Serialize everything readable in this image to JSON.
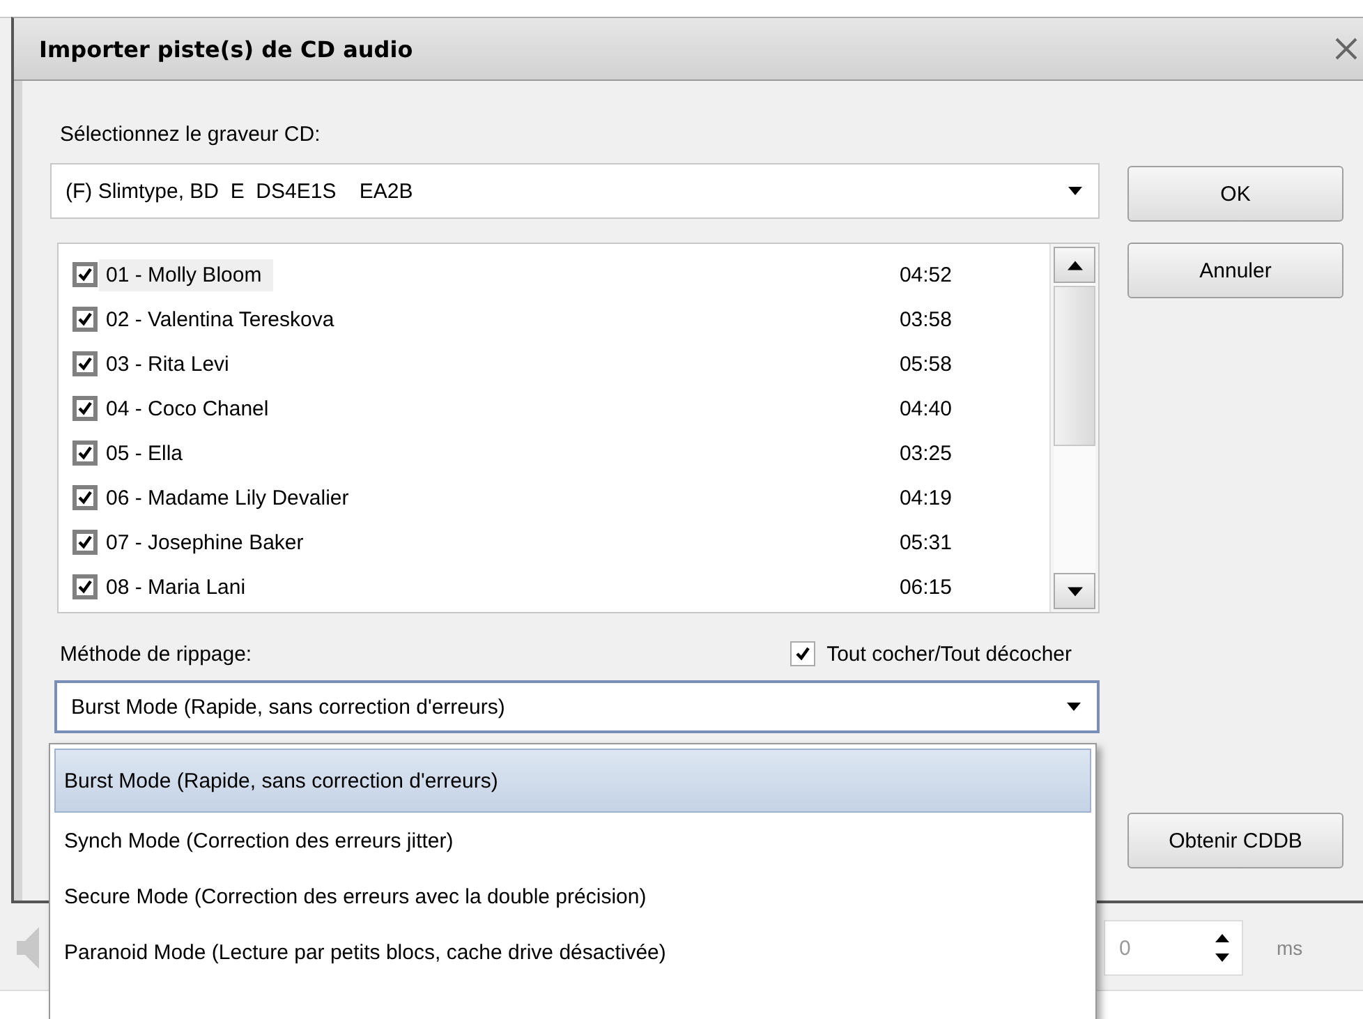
{
  "window": {
    "title": "Importer piste(s) de CD audio"
  },
  "drive": {
    "label": "Sélectionnez le graveur CD:",
    "value": "(F) Slimtype, BD  E  DS4E1S    EA2B"
  },
  "ok_button": {
    "label": "OK"
  },
  "cancel_button": {
    "label": "Annuler"
  },
  "tracks": [
    {
      "title": "01 - Molly Bloom",
      "duration": "04:52",
      "checked": true,
      "selected": true
    },
    {
      "title": "02 - Valentina Tereskova",
      "duration": "03:58",
      "checked": true,
      "selected": false
    },
    {
      "title": "03 - Rita Levi",
      "duration": "05:58",
      "checked": true,
      "selected": false
    },
    {
      "title": "04 - Coco Chanel",
      "duration": "04:40",
      "checked": true,
      "selected": false
    },
    {
      "title": "05 - Ella",
      "duration": "03:25",
      "checked": true,
      "selected": false
    },
    {
      "title": "06 - Madame Lily Devalier",
      "duration": "04:19",
      "checked": true,
      "selected": false
    },
    {
      "title": "07 - Josephine Baker",
      "duration": "05:31",
      "checked": true,
      "selected": false
    },
    {
      "title": "08 - Maria Lani",
      "duration": "06:15",
      "checked": true,
      "selected": false
    }
  ],
  "method": {
    "label": "Méthode de rippage:",
    "value": "Burst Mode (Rapide, sans correction d'erreurs)",
    "options": [
      {
        "label": "Burst Mode (Rapide, sans correction d'erreurs)",
        "selected": true
      },
      {
        "label": "Synch Mode (Correction des erreurs jitter)",
        "selected": false
      },
      {
        "label": "Secure Mode (Correction des erreurs avec la double précision)",
        "selected": false
      },
      {
        "label": "Paranoid Mode (Lecture par petits blocs, cache drive désactivée)",
        "selected": false
      }
    ]
  },
  "check_all": {
    "label": "Tout cocher/Tout décocher",
    "checked": true
  },
  "cddb_button": {
    "label": "Obtenir CDDB"
  },
  "background": {
    "spin_value": "0",
    "unit": "ms"
  }
}
